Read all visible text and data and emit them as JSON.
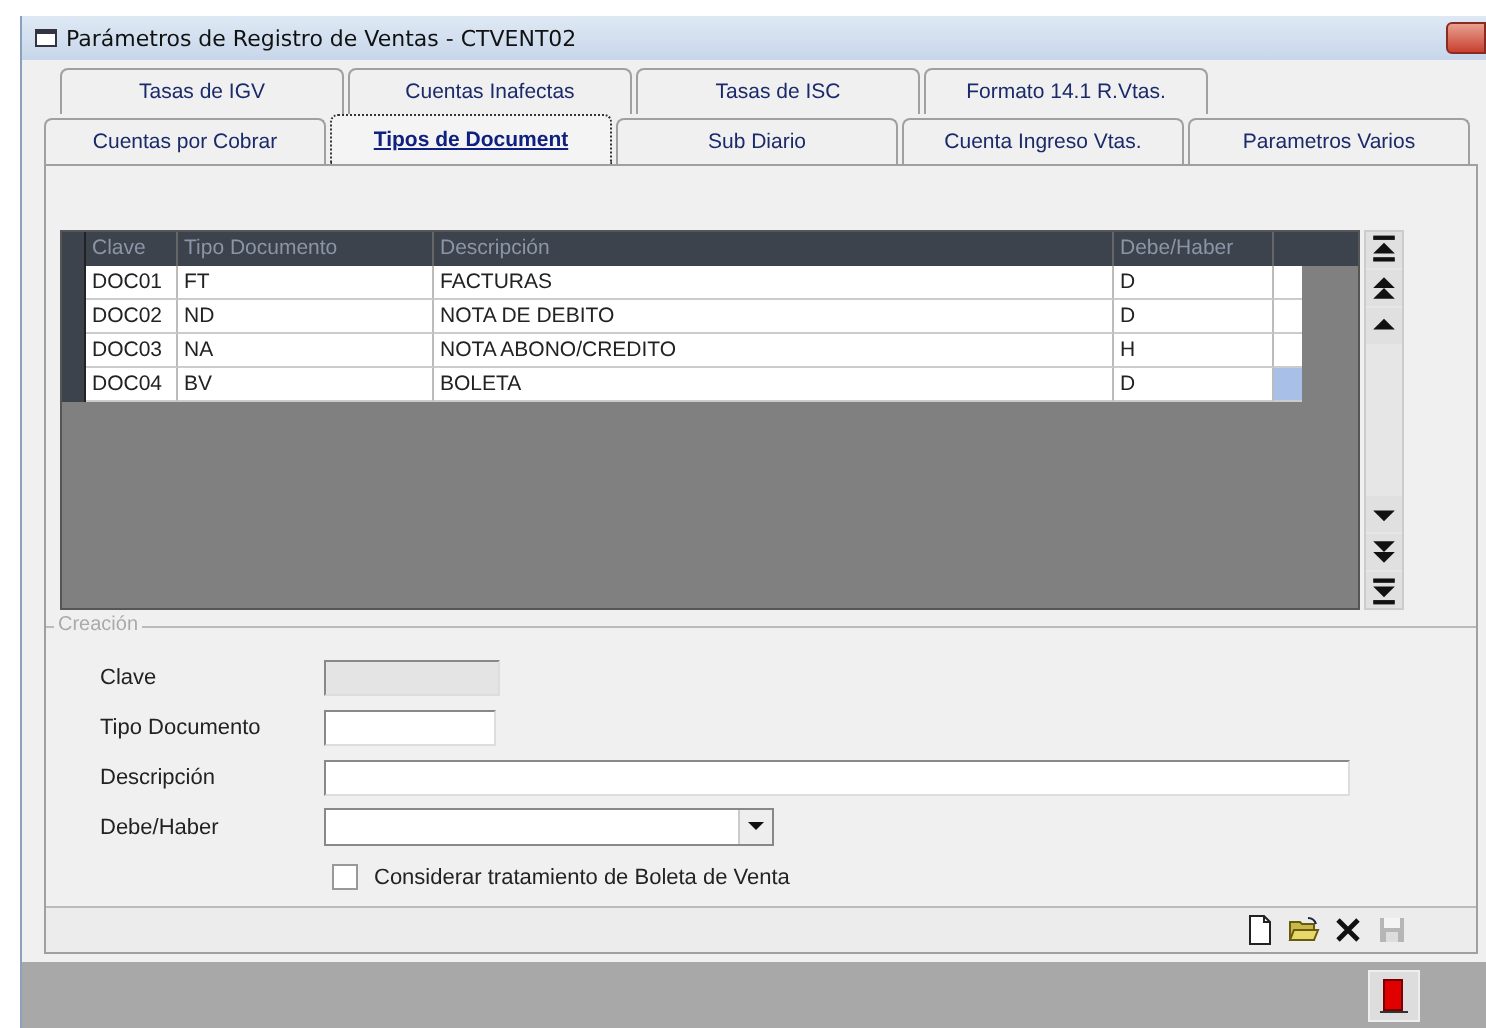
{
  "window": {
    "title": "Parámetros de Registro de Ventas - CTVENT02"
  },
  "tabs_row_1": [
    {
      "label": "Tasas de IGV",
      "selected": false
    },
    {
      "label": "Cuentas Inafectas",
      "selected": false
    },
    {
      "label": "Tasas de ISC",
      "selected": false
    },
    {
      "label": "Formato 14.1 R.Vtas.",
      "selected": false
    }
  ],
  "tabs_row_2": [
    {
      "label": "Cuentas por Cobrar",
      "selected": false
    },
    {
      "label": "Tipos de Document",
      "selected": true
    },
    {
      "label": "Sub Diario",
      "selected": false
    },
    {
      "label": "Cuenta Ingreso Vtas.",
      "selected": false
    },
    {
      "label": "Parametros Varios",
      "selected": false
    }
  ],
  "table": {
    "columns": [
      "Clave",
      "Tipo Documento",
      "Descripción",
      "Debe/Haber"
    ],
    "rows": [
      {
        "cells": [
          "DOC01",
          "FT",
          "FACTURAS",
          "D"
        ],
        "selected": false
      },
      {
        "cells": [
          "DOC02",
          "ND",
          "NOTA DE DEBITO",
          "D"
        ],
        "selected": false
      },
      {
        "cells": [
          "DOC03",
          "NA",
          "NOTA ABONO/CREDITO",
          "H"
        ],
        "selected": false
      },
      {
        "cells": [
          "DOC04",
          "BV",
          "BOLETA",
          "D"
        ],
        "selected": true
      }
    ]
  },
  "form": {
    "title": "Creación",
    "fields": [
      {
        "label": "Clave",
        "kind": "text",
        "disabled": true
      },
      {
        "label": "Tipo Documento",
        "kind": "text",
        "disabled": false
      },
      {
        "label": "Descripción",
        "kind": "text",
        "disabled": false
      },
      {
        "label": "Debe/Haber",
        "kind": "combo",
        "disabled": false
      }
    ],
    "checkbox": {
      "label": "Considerar tratamiento de Boleta de Venta",
      "checked": false
    }
  },
  "toolbar": [
    {
      "kind": "new",
      "disabled": false
    },
    {
      "kind": "open",
      "disabled": false
    },
    {
      "kind": "delete",
      "disabled": false
    },
    {
      "kind": "save",
      "disabled": true
    }
  ]
}
